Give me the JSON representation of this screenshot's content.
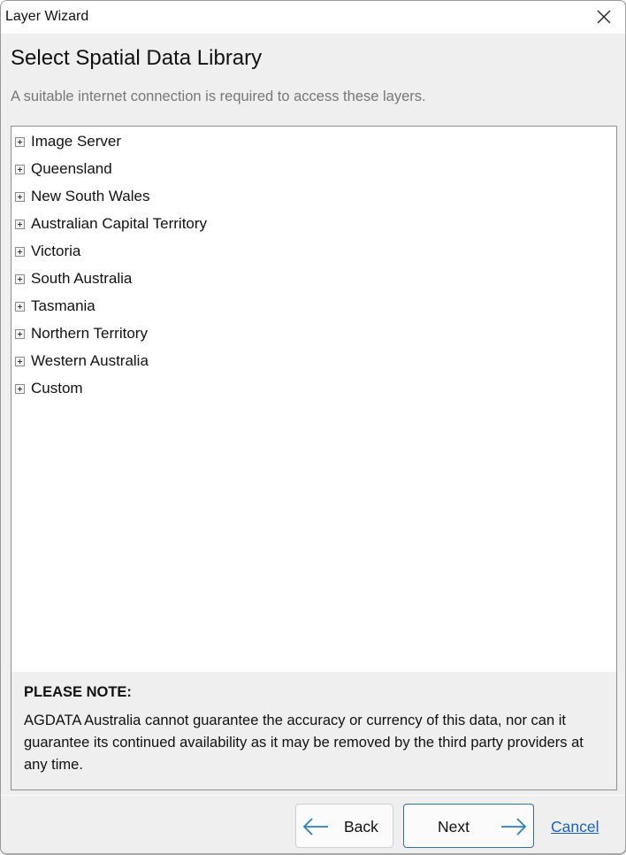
{
  "window": {
    "title": "Layer Wizard",
    "close_icon": "close-icon"
  },
  "header": {
    "title": "Select Spatial Data Library",
    "subtitle": "A suitable internet connection is required to access these layers."
  },
  "tree": {
    "items": [
      {
        "label": "Image Server",
        "state": "collapsed"
      },
      {
        "label": "Queensland",
        "state": "collapsed"
      },
      {
        "label": "New South Wales",
        "state": "collapsed"
      },
      {
        "label": "Australian Capital Territory",
        "state": "collapsed"
      },
      {
        "label": "Victoria",
        "state": "collapsed"
      },
      {
        "label": "South Australia",
        "state": "collapsed"
      },
      {
        "label": "Tasmania",
        "state": "collapsed"
      },
      {
        "label": "Northern Territory",
        "state": "collapsed"
      },
      {
        "label": "Western Australia",
        "state": "collapsed"
      },
      {
        "label": "Custom",
        "state": "collapsed"
      }
    ]
  },
  "note": {
    "title": "PLEASE NOTE:",
    "body": "AGDATA Australia cannot guarantee the accuracy or currency of this data, nor can it guarantee its continued availability as it may be removed by the third party providers at any time."
  },
  "footer": {
    "back_label": "Back",
    "next_label": "Next",
    "cancel_label": "Cancel",
    "accent_color": "#2a7fc7",
    "link_color": "#1a62b8"
  }
}
